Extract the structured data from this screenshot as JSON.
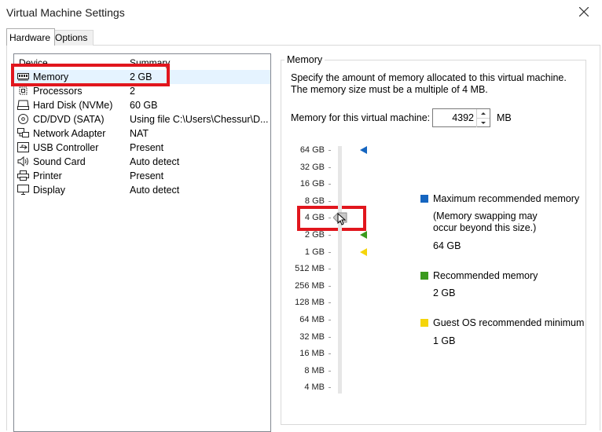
{
  "window": {
    "title": "Virtual Machine Settings"
  },
  "tabs": [
    {
      "label": "Hardware"
    },
    {
      "label": "Options"
    }
  ],
  "device_list": {
    "headers": {
      "device": "Device",
      "summary": "Summary"
    },
    "rows": [
      {
        "name": "Memory",
        "summary": "2 GB",
        "icon": "memory-icon"
      },
      {
        "name": "Processors",
        "summary": "2",
        "icon": "processor-icon"
      },
      {
        "name": "Hard Disk (NVMe)",
        "summary": "60 GB",
        "icon": "hard-disk-icon"
      },
      {
        "name": "CD/DVD (SATA)",
        "summary": "Using file C:\\Users\\Chessur\\D...",
        "icon": "cd-dvd-icon"
      },
      {
        "name": "Network Adapter",
        "summary": "NAT",
        "icon": "network-adapter-icon"
      },
      {
        "name": "USB Controller",
        "summary": "Present",
        "icon": "usb-icon"
      },
      {
        "name": "Sound Card",
        "summary": "Auto detect",
        "icon": "speaker-icon"
      },
      {
        "name": "Printer",
        "summary": "Present",
        "icon": "printer-icon"
      },
      {
        "name": "Display",
        "summary": "Auto detect",
        "icon": "display-icon"
      }
    ]
  },
  "memory": {
    "group_label": "Memory",
    "description": "Specify the amount of memory allocated to this virtual machine. The memory size must be a multiple of 4 MB.",
    "field_label": "Memory for this virtual machine:",
    "value": "4392",
    "unit": "MB",
    "slider": {
      "ticks": [
        "64 GB",
        "32 GB",
        "16 GB",
        "8 GB",
        "4 GB",
        "2 GB",
        "1 GB",
        "512 MB",
        "256 MB",
        "128 MB",
        "64 MB",
        "32 MB",
        "16 MB",
        "8 MB",
        "4 MB"
      ],
      "current_tick": "4 GB"
    },
    "legend": {
      "max": {
        "label": "Maximum recommended memory",
        "note": "(Memory swapping may occur beyond this size.)",
        "value": "64 GB",
        "color": "#1565c0"
      },
      "recommended": {
        "label": "Recommended memory",
        "value": "2 GB",
        "color": "#3a9a1e"
      },
      "guest_min": {
        "label": "Guest OS recommended minimum",
        "value": "1 GB",
        "color": "#f5d50a"
      }
    }
  },
  "colors": {
    "highlight_box": "#e1161d",
    "selected_row": "#e5f3ff"
  }
}
